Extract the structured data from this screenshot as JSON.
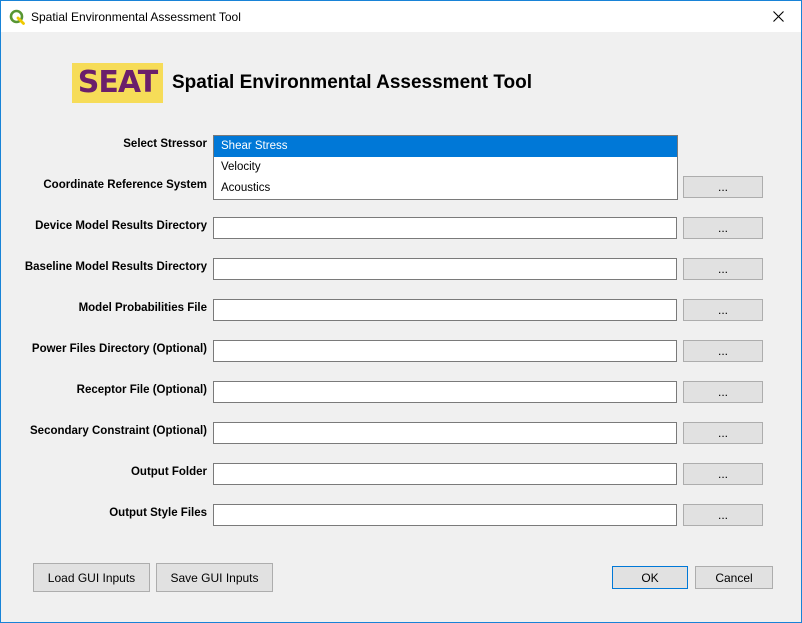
{
  "window": {
    "title": "Spatial Environmental Assessment Tool"
  },
  "header": {
    "logo_text": "SEAT",
    "title": "Spatial Environmental Assessment Tool"
  },
  "stressor": {
    "label": "Select Stressor",
    "options": [
      "Shear Stress",
      "Velocity",
      "Acoustics"
    ],
    "selected": "Shear Stress"
  },
  "fields": [
    {
      "label": "Coordinate Reference System",
      "value": "",
      "browse": "..."
    },
    {
      "label": "Device Model Results Directory",
      "value": "",
      "browse": "..."
    },
    {
      "label": "Baseline Model Results Directory",
      "value": "",
      "browse": "..."
    },
    {
      "label": "Model Probabilities File",
      "value": "",
      "browse": "..."
    },
    {
      "label": "Power Files Directory (Optional)",
      "value": "",
      "browse": "..."
    },
    {
      "label": "Receptor File (Optional)",
      "value": "",
      "browse": "..."
    },
    {
      "label": "Secondary Constraint (Optional)",
      "value": "",
      "browse": "..."
    },
    {
      "label": "Output Folder",
      "value": "",
      "browse": "..."
    },
    {
      "label": "Output Style Files",
      "value": "",
      "browse": "..."
    }
  ],
  "buttons": {
    "load": "Load GUI Inputs",
    "save": "Save GUI Inputs",
    "ok": "OK",
    "cancel": "Cancel"
  },
  "colors": {
    "accent": "#0078d7",
    "logo_bg": "#f6dc58",
    "logo_fg": "#6b1f6b",
    "app_icon": "#589632"
  }
}
